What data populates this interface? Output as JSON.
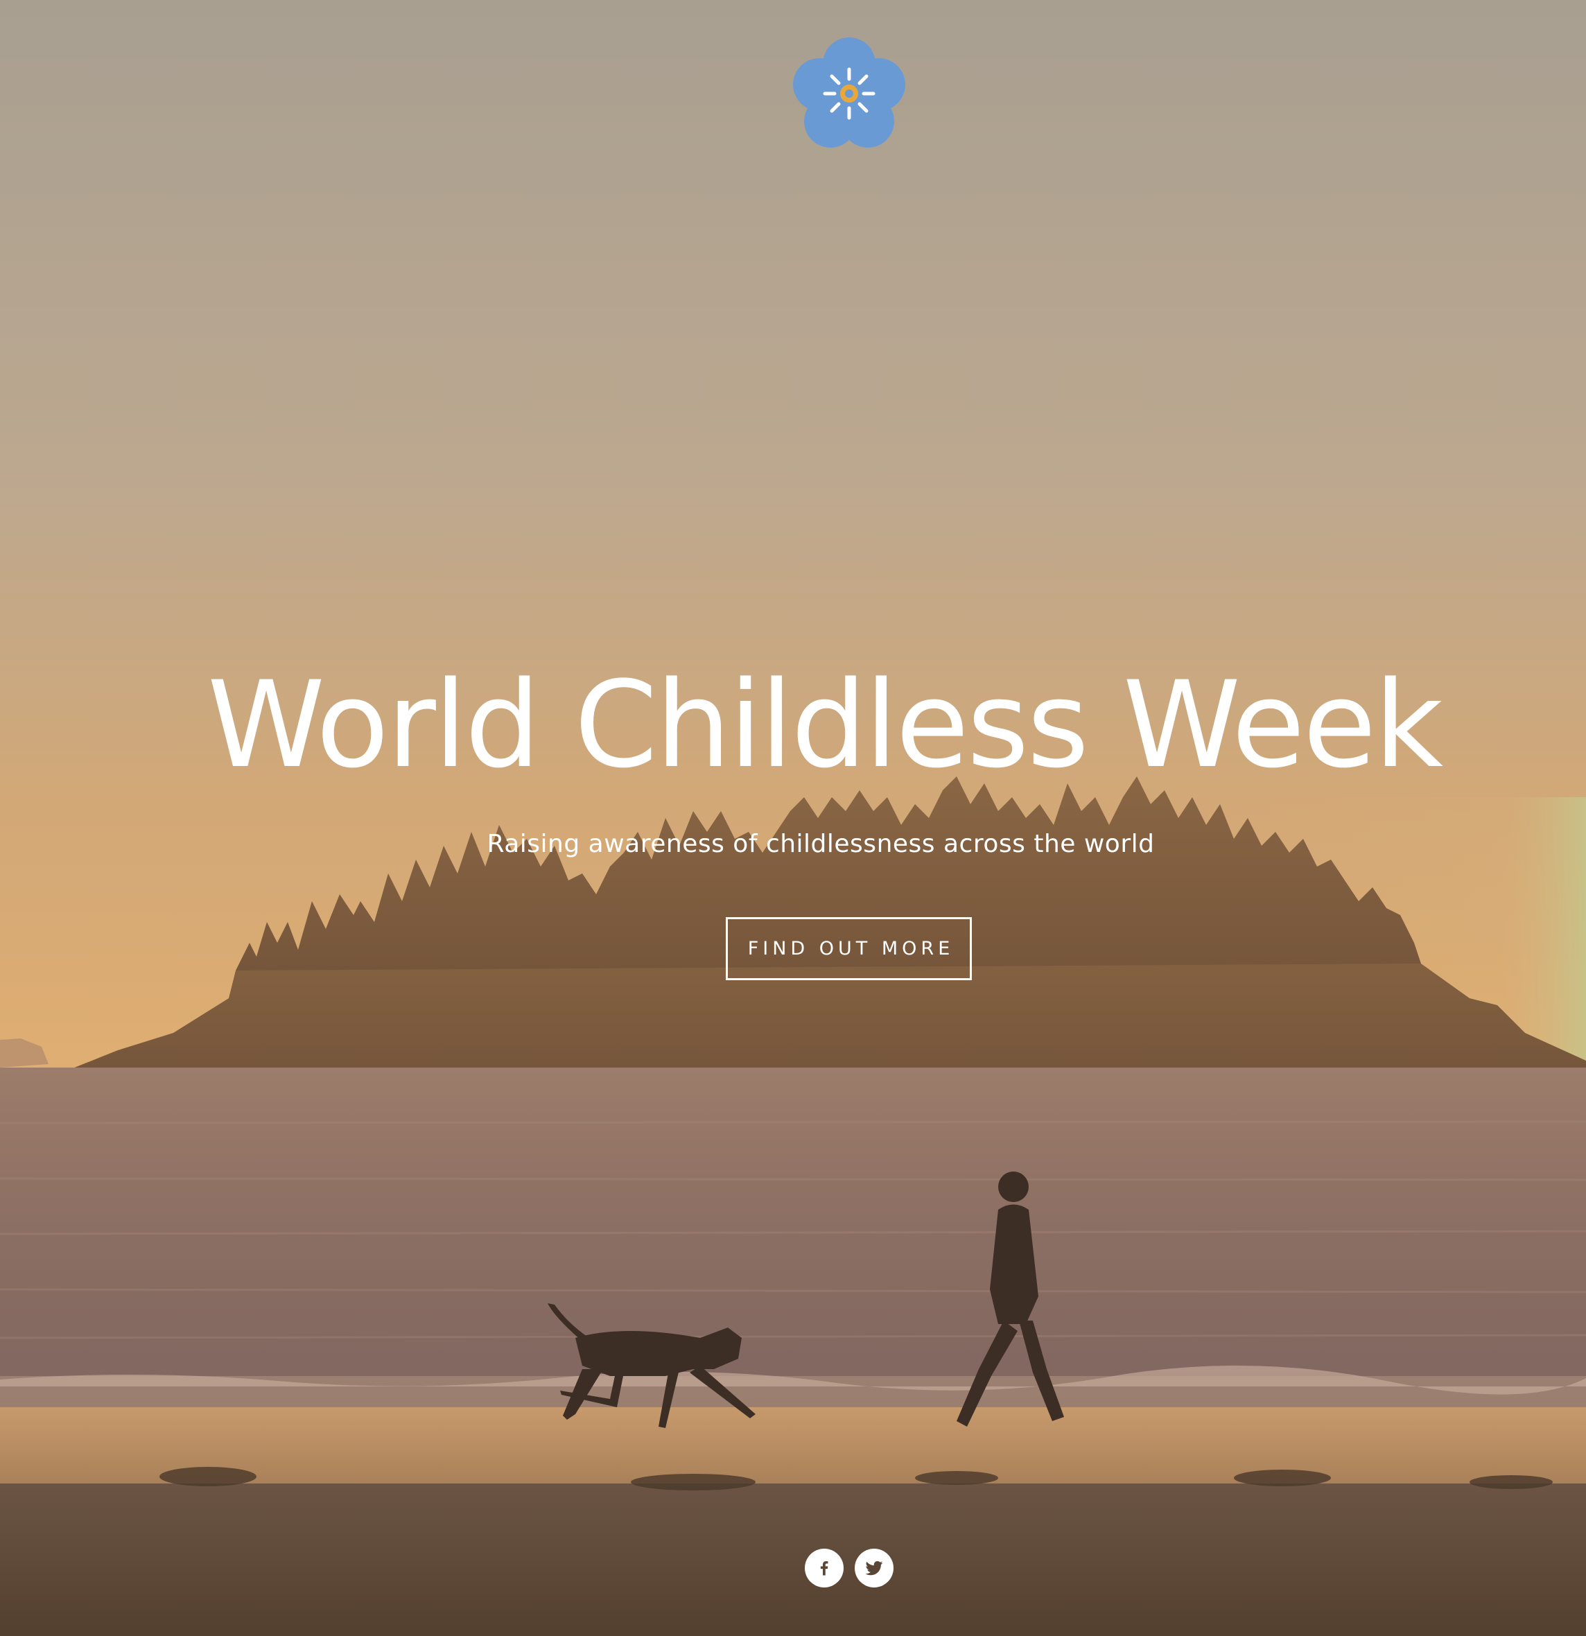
{
  "hero": {
    "title": "World Childless Week",
    "subtitle": "Raising awareness of childlessness across the world",
    "cta_label": "FIND OUT MORE"
  },
  "logo": {
    "icon": "forget-me-not-flower-icon",
    "petal_color": "#6a9ad4",
    "center_color": "#e8a73a"
  },
  "social": [
    {
      "name": "facebook",
      "icon": "facebook-icon"
    },
    {
      "name": "twitter",
      "icon": "twitter-icon"
    }
  ],
  "colors": {
    "text": "#ffffff",
    "sky_top": "#a89f91",
    "sky_bottom": "#d8a46e",
    "island": "#7a5a3c",
    "sea": "#8a7064",
    "sand": "#5e4a3b"
  }
}
